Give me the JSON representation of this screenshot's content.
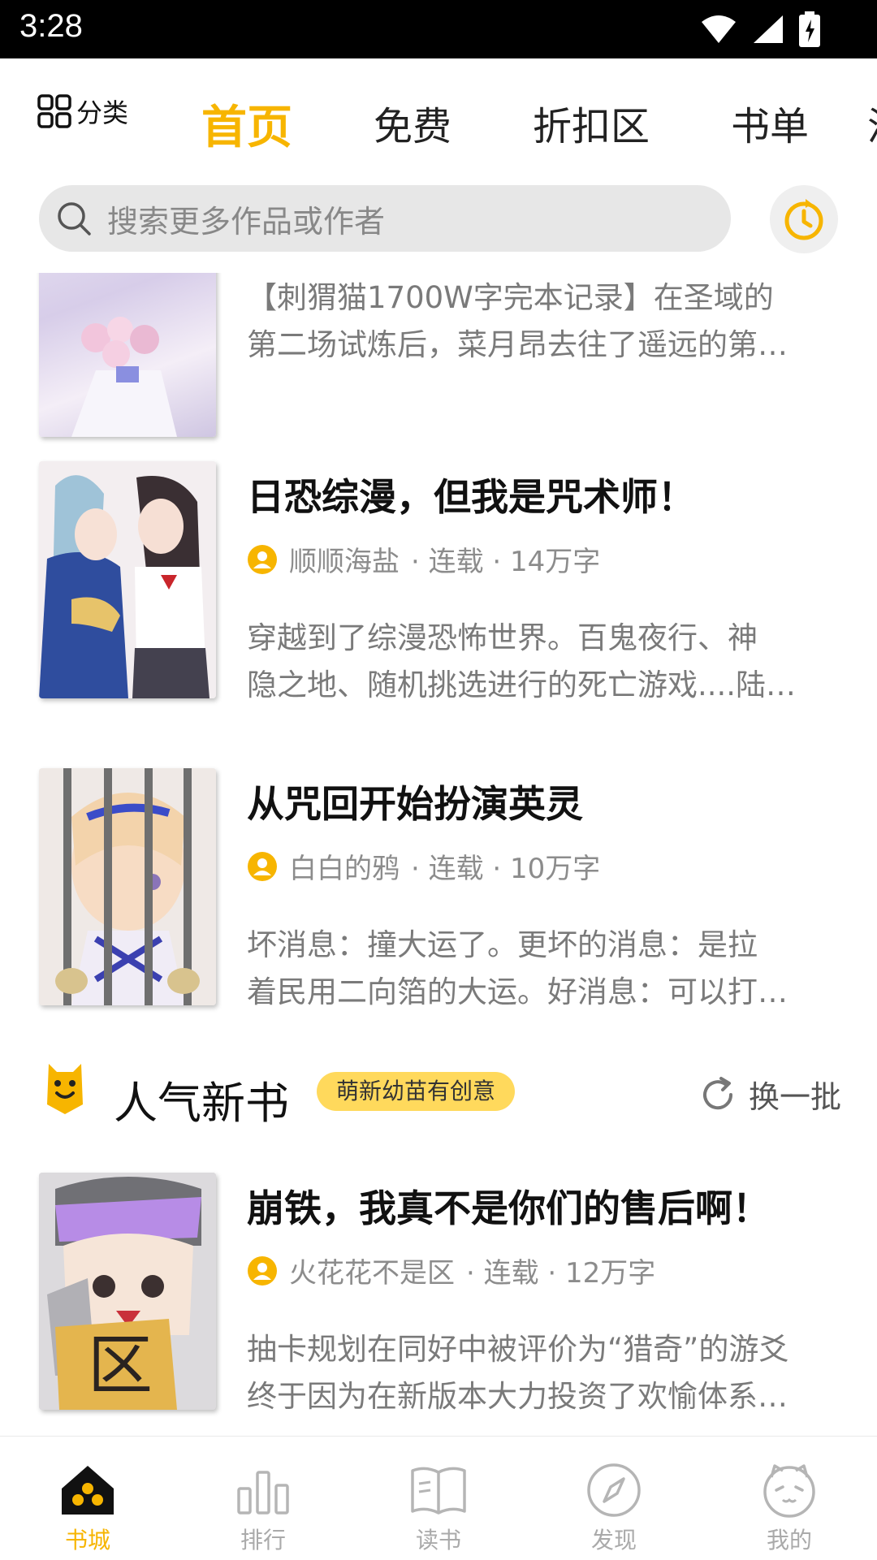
{
  "status_bar": {
    "time": "3:28"
  },
  "top_nav": {
    "category_label": "分类",
    "tabs": [
      {
        "label": "首页",
        "active": true
      },
      {
        "label": "免费",
        "active": false
      },
      {
        "label": "折扣区",
        "active": false
      },
      {
        "label": "书单",
        "active": false
      },
      {
        "label": "漫",
        "active": false
      }
    ]
  },
  "search": {
    "placeholder": "搜索更多作品或作者"
  },
  "books": [
    {
      "title": "",
      "desc_lines": [
        "【刺猬猫1700W字完本记录】在圣域的",
        "第二场试炼后，菜月昂去往了遥远的第…"
      ]
    },
    {
      "title": "日恐综漫，但我是咒术师！",
      "author": "顺顺海盐",
      "meta": "· 连载 · 14万字",
      "desc_lines": [
        "穿越到了综漫恐怖世界。百鬼夜行、神",
        "隐之地、随机挑选进行的死亡游戏....陆…"
      ]
    },
    {
      "title": "从咒回开始扮演英灵",
      "author": "白白的鸦",
      "meta": "· 连载 · 10万字",
      "desc_lines": [
        "坏消息：撞大运了。更坏的消息：是拉",
        "着民用二向箔的大运。好消息：可以打…"
      ]
    }
  ],
  "section": {
    "title": "人气新书",
    "tag": "萌新幼苗有创意",
    "refresh_label": "换一批"
  },
  "section_books": [
    {
      "title": "崩铁，我真不是你们的售后啊！",
      "author": "火花花不是区",
      "meta": "· 连载 · 12万字",
      "desc_lines": [
        "抽卡规划在同好中被评价为“猎奇”的游爻",
        "终于因为在新版本大力投资了欢愉体系…"
      ]
    }
  ],
  "bottom_nav": [
    {
      "label": "书城",
      "icon": "bookstore-icon",
      "active": true
    },
    {
      "label": "排行",
      "icon": "ranking-icon",
      "active": false
    },
    {
      "label": "读书",
      "icon": "book-icon",
      "active": false
    },
    {
      "label": "发现",
      "icon": "compass-icon",
      "active": false
    },
    {
      "label": "我的",
      "icon": "cat-face-icon",
      "active": false
    }
  ],
  "colors": {
    "accent": "#f7b500",
    "tag_bg": "#ffd95c",
    "search_bg": "#e7e7e7"
  }
}
